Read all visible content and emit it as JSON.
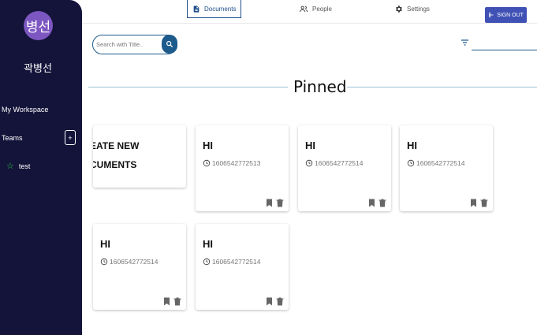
{
  "sidebar": {
    "avatar_text": "병선",
    "username": "곽병선",
    "workspace_label": "My Workspace",
    "teams_label": "Teams",
    "add_team_symbol": "+",
    "teams": [
      {
        "name": "test",
        "icon": "star-icon",
        "icon_color": "#2ecc40"
      }
    ],
    "background": "#14133a",
    "avatar_color": "#7d57c1"
  },
  "nav": {
    "tabs": [
      {
        "label": "Documents",
        "icon": "document-icon",
        "active": true
      },
      {
        "label": "People",
        "icon": "people-icon",
        "active": false
      },
      {
        "label": "Settings",
        "icon": "gear-icon",
        "active": false
      }
    ],
    "signout_label": "SIGN OUT",
    "signout_color": "#3f51b5"
  },
  "search": {
    "placeholder": "Search with Title.."
  },
  "filter": {
    "icon": "filter-icon",
    "value": ""
  },
  "pinned": {
    "title": "Pinned",
    "create_card": {
      "line1": "EATE NEW",
      "line2": "CUMENTS"
    },
    "documents": [
      {
        "title": "HI",
        "timestamp": "1606542772513"
      },
      {
        "title": "HI",
        "timestamp": "1606542772514"
      },
      {
        "title": "HI",
        "timestamp": "1606542772514"
      },
      {
        "title": "HI",
        "timestamp": "1606542772514"
      },
      {
        "title": "HI",
        "timestamp": "1606542772514"
      }
    ]
  },
  "accent": "#1d5b8c"
}
